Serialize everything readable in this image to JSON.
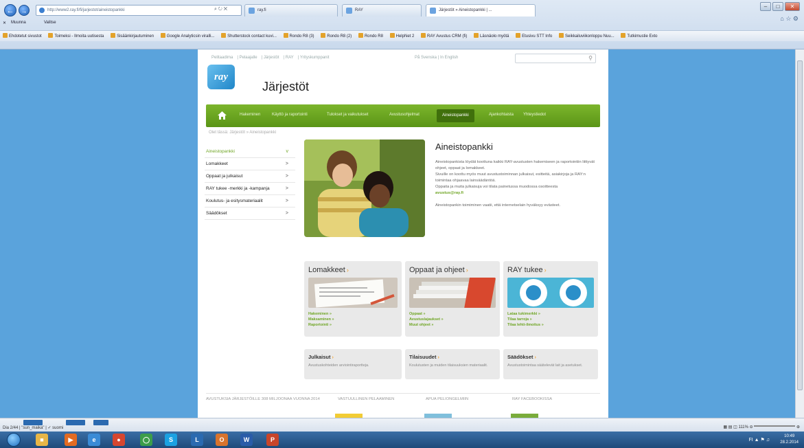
{
  "browser": {
    "address": "http://www2.ray.fi/fi/jarjestot/aineistopankki",
    "search_label": "ray.fi",
    "tabs": [
      {
        "label": "RAY"
      },
      {
        "label": "Järjestöt » Aineistopankki | ..."
      }
    ],
    "menu_items": [
      "Muunna",
      "Valitse"
    ],
    "favorites": [
      "Ehdotetut sivustot",
      "Toimeksi - Ilmoita uutisesta",
      "Sisäänkirjautuminen",
      "Google Analyticsin viralli...",
      "Shutterstock contact kuvi...",
      "Rondo R8 (3)",
      "Rondo R8 (2)",
      "Rondo R8",
      "HelpNet 2",
      "RAY Avustus CRM (fi)",
      "Läsnäolo myötä",
      "Etusivu STT Info",
      "Seikkailuviikonloppu Nuu...",
      "Tutkimustie Exto"
    ]
  },
  "site": {
    "top_links": [
      "Pelitaadima",
      "Pelaajalle",
      "Järjestöt",
      "RAY",
      "Yrityskumppanit"
    ],
    "lang_links": [
      "På Svenska",
      "In English"
    ],
    "logo_text": "ray",
    "title": "Järjestöt",
    "nav": [
      "Hakeminen",
      "Käyttö ja raportointi",
      "Tulokset ja vaikutukset",
      "Avustusohjelmat",
      "Aineistopankki",
      "Ajankohtaista",
      "Yhteystiedot"
    ],
    "breadcrumb": "Olet tässä: Järjestöt » Aineistopankki",
    "sidebar": [
      {
        "label": "Aineistopankki",
        "chev": "v"
      },
      {
        "label": "Lomakkeet",
        "chev": ">"
      },
      {
        "label": "Oppaat ja julkaisut",
        "chev": ">"
      },
      {
        "label": "RAY tukee -merkki ja -kampanja",
        "chev": ">"
      },
      {
        "label": "Koulutus- ja esitysmateriaalit",
        "chev": ">"
      },
      {
        "label": "Säädökset",
        "chev": ">"
      }
    ],
    "hero": {
      "title": "Aineistopankki",
      "p1": "Aineistopankista löydät koottuna kaikki RAY-avustusten hakemiseen ja raportointiin liittyvät ohjeet, oppaat ja lomakkeet.",
      "p2": "Sivuille on koottu myös muut avustustoiminnan julkaisut, esitteitä, asiakirjoja ja RAY:n toimintaa ohjaavaa lainsäädäntöä.",
      "p3": "Oppaita ja muita julkaisuja voi tilata painetussa muodossa osoitteesta",
      "email": "avustus@ray.fi",
      "p4": "Aineistopankin toimiminen vaatii, että internetselain hyväksyy evästeet."
    },
    "cards": [
      {
        "title": "Lomakkeet",
        "links": [
          "Hakeminen »",
          "Maksaminen »",
          "Raportointi »"
        ]
      },
      {
        "title": "Oppaat ja ohjeet",
        "links": [
          "Oppaat »",
          "Avustuslajaukset »",
          "Muut ohjeet »"
        ]
      },
      {
        "title": "RAY tukee",
        "links": [
          "Lataa tukimerkki »",
          "Tilaa tarroja »",
          "Tilaa lehti-ilmoitus »"
        ]
      }
    ],
    "cards2": [
      {
        "title": "Julkaisut",
        "desc": "Avustuskohteiden arviointiraportteja."
      },
      {
        "title": "Tilaisuudet",
        "desc": "Koulutusten ja muiden tilaisuuksien materiaalit."
      },
      {
        "title": "Säädökset",
        "desc": "Avustustoimintaa säätelevät lait ja asetukset."
      }
    ],
    "footer": [
      "AVUSTUKSIA JÄRJESTÖILLE 308 MILJOONAA VUONNA 2014",
      "VASTUULLINEN PELAAMINEN",
      "APUA PELIONGELMIIN",
      "RAY FACEBOOKISSA"
    ]
  },
  "statusbar": {
    "slide": "Dia 2/44",
    "theme": "\"sun_maika\"",
    "lang": "suomi",
    "zoom": "111%"
  },
  "taskbar": {
    "time": "10:49",
    "date": "28.2.2014"
  },
  "colors": {
    "accent_green": "#6fa524",
    "nav_green": "#5a9516",
    "background_blue": "#5aa3dc"
  }
}
